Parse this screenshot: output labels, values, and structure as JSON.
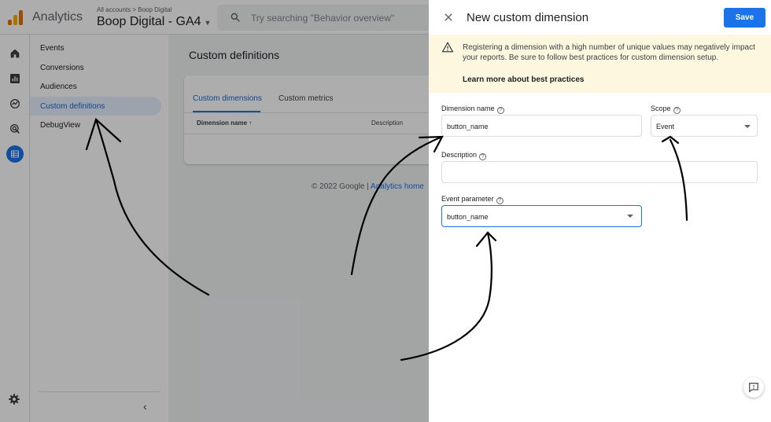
{
  "header": {
    "app_title": "Analytics",
    "breadcrumb": "All accounts > Boop Digital",
    "property": "Boop Digital - GA4",
    "search_placeholder": "Try searching \"Behavior overview\""
  },
  "subnav": {
    "items": [
      "Events",
      "Conversions",
      "Audiences",
      "Custom definitions",
      "DebugView"
    ],
    "active": "Custom definitions"
  },
  "main": {
    "title": "Custom definitions",
    "tabs": [
      "Custom dimensions",
      "Custom metrics"
    ],
    "columns": [
      "Dimension name",
      "Description"
    ],
    "sort_indicator": "↑",
    "footer_prefix": "© 2022 Google | ",
    "footer_link": "Analytics home"
  },
  "drawer": {
    "title": "New custom dimension",
    "save_label": "Save",
    "warning": "Registering a dimension with a high number of unique values may negatively impact your reports. Be sure to follow best practices for custom dimension setup.",
    "warning_link": "Learn more about best practices",
    "dimension_name_label": "Dimension name",
    "dimension_name_value": "button_name",
    "scope_label": "Scope",
    "scope_value": "Event",
    "description_label": "Description",
    "description_value": "",
    "event_parameter_label": "Event parameter",
    "event_parameter_value": "button_name"
  },
  "colors": {
    "accent": "#1a73e8",
    "warning_bg": "#fef7e0",
    "logo_orange": "#e37400",
    "logo_yellow": "#f9ab00"
  },
  "icons": [
    "analytics-logo-icon",
    "search-icon",
    "home-icon",
    "reports-icon",
    "explore-icon",
    "advertising-icon",
    "configure-icon",
    "settings-icon",
    "close-icon",
    "warning-icon",
    "help-icon",
    "feedback-icon",
    "chevron-left-icon"
  ]
}
